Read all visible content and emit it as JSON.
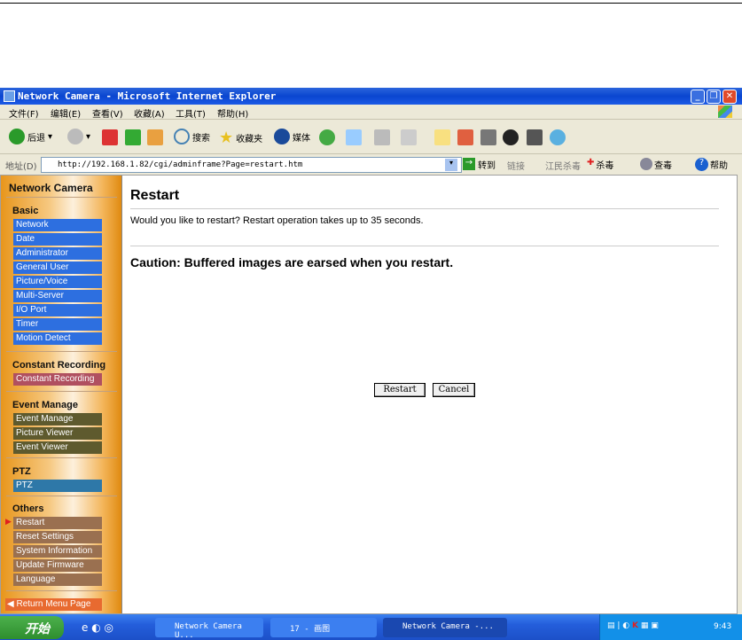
{
  "window": {
    "title": "Network Camera - Microsoft Internet Explorer"
  },
  "menu": [
    "文件(F)",
    "编辑(E)",
    "查看(V)",
    "收藏(A)",
    "工具(T)",
    "帮助(H)"
  ],
  "toolbar": {
    "back": "后退",
    "search": "搜索",
    "favorites": "收藏夹",
    "media": "媒体"
  },
  "address": {
    "label": "地址(D)",
    "url": "http://192.168.1.82/cgi/adminframe?Page=restart.htm",
    "go": "转到",
    "links": "链接",
    "jiangmin": "江民杀毒",
    "kill": "杀毒",
    "check": "查毒",
    "help": "帮助"
  },
  "sidebar": {
    "title": "Network Camera",
    "sections": [
      {
        "heading": "Basic",
        "items": [
          "Network",
          "Date",
          "Administrator",
          "General User",
          "Picture/Voice",
          "Multi-Server",
          "I/O Port",
          "Timer",
          "Motion Detect"
        ]
      },
      {
        "heading": "Constant Recording",
        "items": [
          "Constant Recording"
        ]
      },
      {
        "heading": "Event Manage",
        "items": [
          "Event Manage",
          "Picture Viewer",
          "Event Viewer"
        ]
      },
      {
        "heading": "PTZ",
        "items": [
          "PTZ"
        ]
      },
      {
        "heading": "Others",
        "items": [
          "Restart",
          "Reset Settings",
          "System Information",
          "Update Firmware",
          "Language"
        ]
      }
    ],
    "return": "Return Menu Page",
    "active": "Restart"
  },
  "main": {
    "heading": "Restart",
    "question": "Would you like to restart? Restart operation takes up to 35 seconds.",
    "caution": "Caution: Buffered images are earsed when you restart.",
    "restart_button": "Restart",
    "cancel_button": "Cancel"
  },
  "taskbar": {
    "start": "开始",
    "tasks": [
      "Network Camera U...",
      "17 - 画图",
      "Network Camera -..."
    ],
    "clock": "9:43"
  }
}
